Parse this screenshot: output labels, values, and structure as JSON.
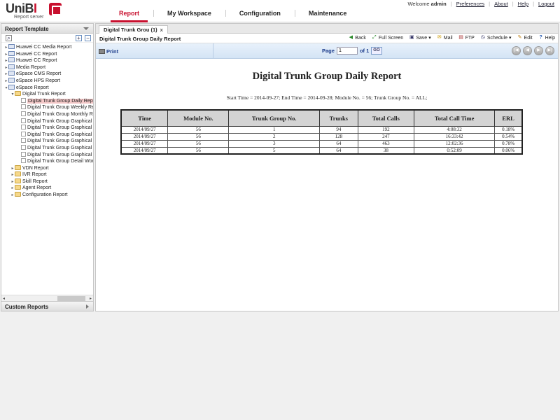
{
  "header": {
    "logo_main": "UniB",
    "logo_accent": "I",
    "logo_sub": "Report server",
    "welcome": "Welcome",
    "username": "admin",
    "links": [
      "Preferences",
      "About",
      "Help",
      "Logout"
    ]
  },
  "nav": [
    "Report",
    "My Workspace",
    "Configuration",
    "Maintenance"
  ],
  "left_panel": {
    "title": "Report Template",
    "tree": [
      {
        "label": "Huawei CC Media Report",
        "level": 0,
        "toggle": "▸",
        "icon": "rep"
      },
      {
        "label": "Huawei CC Report",
        "level": 0,
        "toggle": "▸",
        "icon": "rep"
      },
      {
        "label": "Huawei CC Report",
        "level": 0,
        "toggle": "▸",
        "icon": "rep"
      },
      {
        "label": "Media Report",
        "level": 0,
        "toggle": "▸",
        "icon": "rep"
      },
      {
        "label": "eSpace CMS  Report",
        "level": 0,
        "toggle": "▸",
        "icon": "rep"
      },
      {
        "label": "eSpace HPS Report",
        "level": 0,
        "toggle": "▸",
        "icon": "rep"
      },
      {
        "label": "eSpace Report",
        "level": 0,
        "toggle": "▾",
        "icon": "rep"
      },
      {
        "label": "Digital Trunk Report",
        "level": 1,
        "toggle": "▾",
        "icon": "folder"
      },
      {
        "label": "Digital Trunk Group Daily Report",
        "level": 2,
        "toggle": "",
        "icon": "doc",
        "selected": true
      },
      {
        "label": "Digital Trunk Group Weekly Report",
        "level": 2,
        "toggle": "",
        "icon": "doc"
      },
      {
        "label": "Digital Trunk Group Monthly Report",
        "level": 2,
        "toggle": "",
        "icon": "doc"
      },
      {
        "label": "Digital Trunk Group Graphical Workload",
        "level": 2,
        "toggle": "",
        "icon": "doc"
      },
      {
        "label": "Digital Trunk Group Graphical Workload",
        "level": 2,
        "toggle": "",
        "icon": "doc"
      },
      {
        "label": "Digital Trunk Group Graphical Workload",
        "level": 2,
        "toggle": "",
        "icon": "doc"
      },
      {
        "label": "Digital Trunk Group Graphical Workload",
        "level": 2,
        "toggle": "",
        "icon": "doc"
      },
      {
        "label": "Digital Trunk Group Graphical Workload",
        "level": 2,
        "toggle": "",
        "icon": "doc"
      },
      {
        "label": "Digital Trunk Group Graphical Workload",
        "level": 2,
        "toggle": "",
        "icon": "doc"
      },
      {
        "label": "Digital Trunk Group Detail Workload",
        "level": 2,
        "toggle": "",
        "icon": "doc"
      },
      {
        "label": "VDN Report",
        "level": 1,
        "toggle": "▸",
        "icon": "folder"
      },
      {
        "label": "IVR Report",
        "level": 1,
        "toggle": "▸",
        "icon": "folder"
      },
      {
        "label": "Skill Report",
        "level": 1,
        "toggle": "▸",
        "icon": "folder"
      },
      {
        "label": "Agent Report",
        "level": 1,
        "toggle": "▸",
        "icon": "folder"
      },
      {
        "label": "Configuration Report",
        "level": 1,
        "toggle": "▸",
        "icon": "folder"
      }
    ],
    "custom_reports": "Custom Reports"
  },
  "main": {
    "tab_label": "Digital Trunk Grou (1)",
    "tab_close": "x",
    "report_name": "Digital Trunk Group Daily Report",
    "tools": [
      "Back",
      "Full Screen",
      "Save",
      "Mail",
      "FTP",
      "Schedule",
      "Edit",
      "Help"
    ],
    "print_label": "Print",
    "page_label": "Page",
    "page_value": "1",
    "page_of": "of 1",
    "go_label": "GO"
  },
  "report": {
    "title": "Digital Trunk Group Daily Report",
    "condition": "Start Time = 2014-09-27; End Time = 2014-09-28; Module No. = 56; Trunk Group No. = ALL;",
    "columns": [
      "Time",
      "Module No.",
      "Trunk Group No.",
      "Trunks",
      "Total Calls",
      "Total Call Time",
      "ERL"
    ],
    "rows": [
      [
        "2014/09/27",
        "56",
        "1",
        "94",
        "192",
        "4:08:32",
        "0.18%"
      ],
      [
        "2014/09/27",
        "56",
        "2",
        "128",
        "247",
        "16:33:42",
        "0.54%"
      ],
      [
        "2014/09/27",
        "56",
        "3",
        "64",
        "463",
        "12:02:36",
        "0.78%"
      ],
      [
        "2014/09/27",
        "56",
        "5",
        "64",
        "38",
        "0:52:09",
        "0.06%"
      ]
    ]
  }
}
